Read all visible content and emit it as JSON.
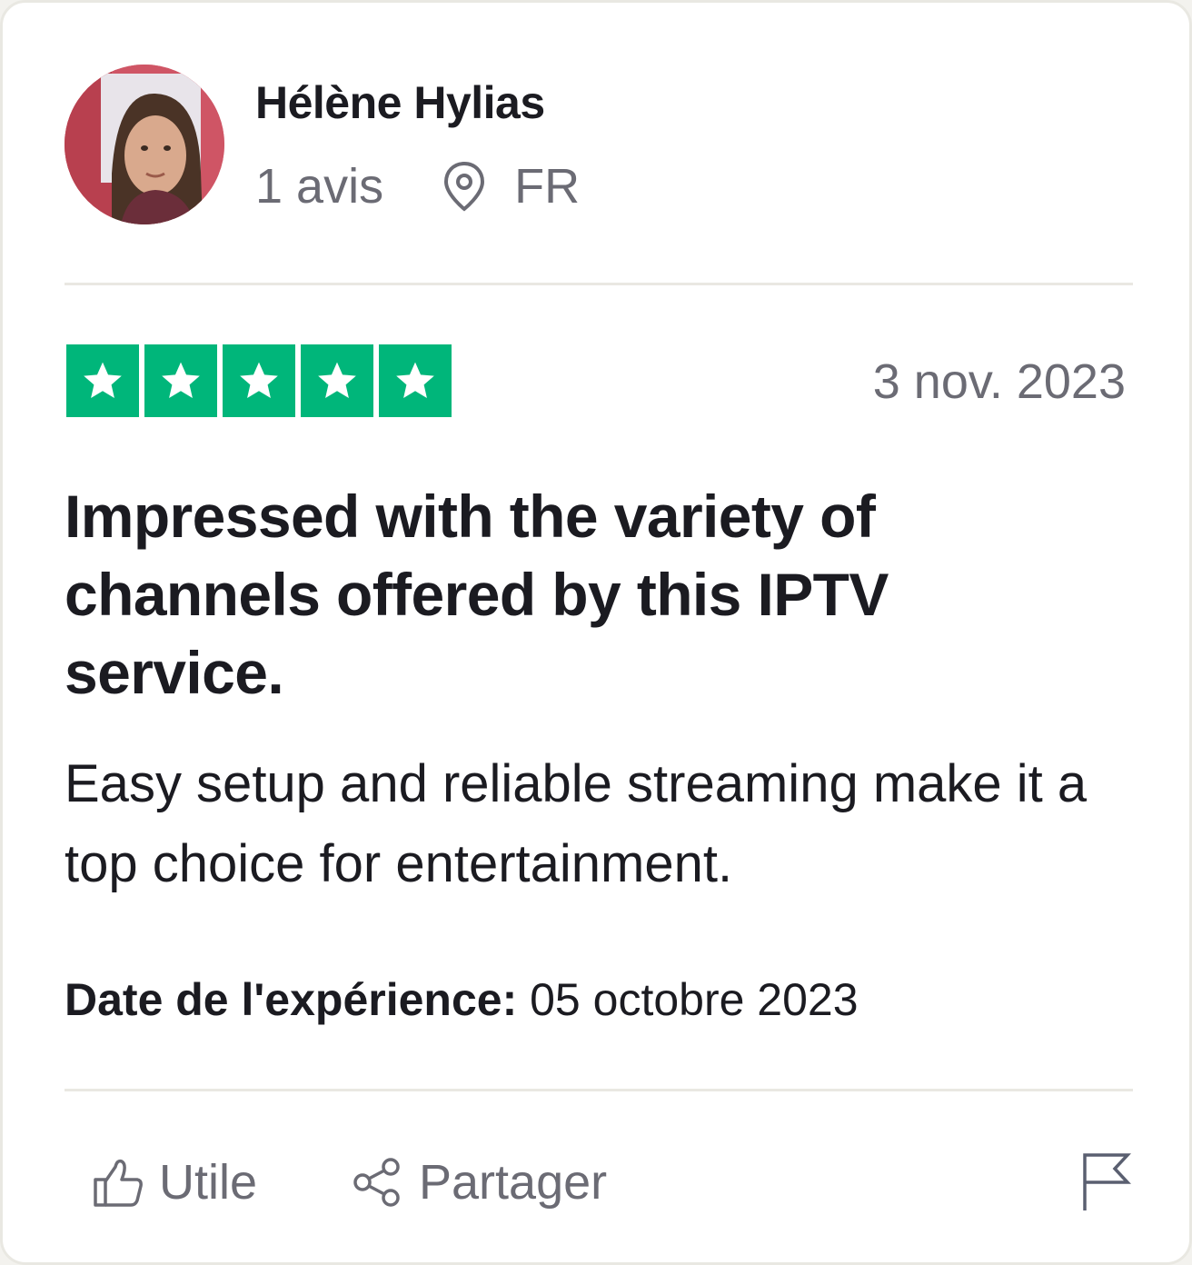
{
  "reviewer": {
    "name": "Hélène Hylias",
    "review_count": "1 avis",
    "country": "FR"
  },
  "review": {
    "rating": 5,
    "date": "3 nov. 2023",
    "title": "Impressed with the variety of channels offered by this IPTV service.",
    "body": "Easy setup and reliable streaming make it a top choice for entertainment.",
    "experience_label": "Date de l'expérience:",
    "experience_date": "05 octobre 2023"
  },
  "actions": {
    "useful_label": "Utile",
    "share_label": "Partager"
  },
  "icons": {
    "location": "map-pin-icon",
    "useful": "thumbs-up-icon",
    "share": "share-icon",
    "report": "flag-icon",
    "star": "star-icon"
  },
  "colors": {
    "star_green": "#00b67a",
    "text_primary": "#1b1b21",
    "text_secondary": "#6b6b74",
    "divider": "#e9e8e2"
  }
}
